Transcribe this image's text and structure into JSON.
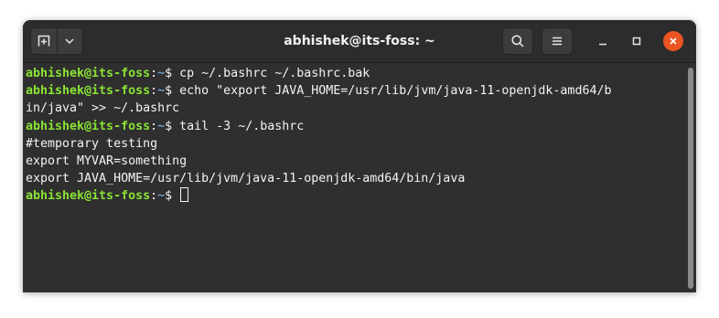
{
  "window": {
    "title": "abhishek@its-foss: ~"
  },
  "header": {
    "new_tab_icon": "new-tab-icon",
    "dropdown_icon": "chevron-down-icon",
    "search_icon": "search-icon",
    "menu_icon": "hamburger-menu-icon",
    "minimize_icon": "minimize-icon",
    "maximize_icon": "maximize-icon",
    "close_icon": "close-icon"
  },
  "colors": {
    "prompt_user": "#8ae234",
    "prompt_path": "#729fcf",
    "close_button": "#e95420",
    "terminal_bg": "#2f2f2f"
  },
  "terminal": {
    "prompt_user": "abhishek@its-foss",
    "prompt_sep": ":",
    "prompt_path": "~",
    "prompt_symbol": "$",
    "lines": [
      {
        "type": "cmd",
        "text": " cp ~/.bashrc ~/.bashrc.bak"
      },
      {
        "type": "cmd",
        "text": " echo \"export JAVA_HOME=/usr/lib/jvm/java-11-openjdk-amd64/b"
      },
      {
        "type": "out",
        "text": "in/java\" >> ~/.bashrc"
      },
      {
        "type": "cmd",
        "text": " tail -3 ~/.bashrc"
      },
      {
        "type": "out",
        "text": "#temporary testing"
      },
      {
        "type": "out",
        "text": "export MYVAR=something"
      },
      {
        "type": "out",
        "text": "export JAVA_HOME=/usr/lib/jvm/java-11-openjdk-amd64/bin/java"
      },
      {
        "type": "cursor",
        "text": " "
      }
    ]
  }
}
